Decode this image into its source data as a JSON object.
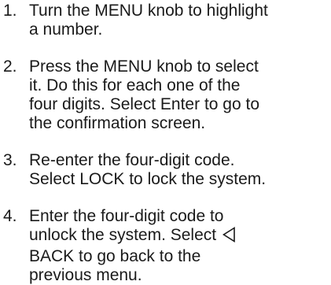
{
  "steps": [
    {
      "number": "1.",
      "text": "Turn the MENU knob to highlight\na number."
    },
    {
      "number": "2.",
      "text": "Press the MENU knob to select\nit. Do this for each one of the\nfour digits. Select Enter to go to\nthe confirmation screen."
    },
    {
      "number": "3.",
      "text": "Re-enter the four-digit code.\nSelect LOCK to lock the system."
    },
    {
      "number": "4.",
      "text_before_icon": "Enter the four-digit code to\nunlock the system. Select ",
      "icon": "back-triangle-icon",
      "text_after_icon": "\nBACK to go back to the\nprevious menu."
    }
  ]
}
